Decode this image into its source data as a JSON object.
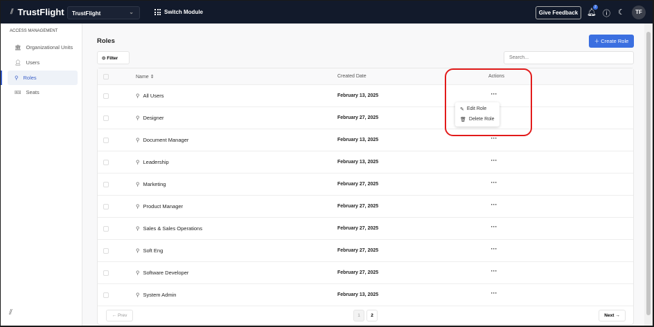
{
  "header": {
    "brand": "TrustFlight",
    "org": "TrustFlight",
    "switch_module": "Switch Module",
    "give_feedback": "Give Feedback",
    "notification_count": "2",
    "avatar": "TF"
  },
  "sidebar": {
    "section": "ACCESS MANAGEMENT",
    "items": [
      {
        "label": "Organizational Units",
        "icon": "bank-icon"
      },
      {
        "label": "Users",
        "icon": "users-icon"
      },
      {
        "label": "Roles",
        "icon": "key-icon",
        "active": true
      },
      {
        "label": "Seats",
        "icon": "ticket-icon"
      }
    ]
  },
  "main": {
    "title": "Roles",
    "create_label": "Create Role",
    "filter_label": "Filter",
    "search_placeholder": "Search...",
    "columns": {
      "name": "Name",
      "created": "Created Date",
      "actions": "Actions"
    },
    "rows": [
      {
        "name": "All Users",
        "date": "February 13, 2025"
      },
      {
        "name": "Designer",
        "date": "February 27, 2025"
      },
      {
        "name": "Document Manager",
        "date": "February 13, 2025"
      },
      {
        "name": "Leadership",
        "date": "February 13, 2025"
      },
      {
        "name": "Marketing",
        "date": "February 27, 2025"
      },
      {
        "name": "Product Manager",
        "date": "February 27, 2025"
      },
      {
        "name": "Sales & Sales Operations",
        "date": "February 27, 2025"
      },
      {
        "name": "Soft Eng",
        "date": "February 27, 2025"
      },
      {
        "name": "Software Developer",
        "date": "February 27, 2025"
      },
      {
        "name": "System Admin",
        "date": "February 13, 2025"
      }
    ],
    "action_menu": {
      "edit": "Edit Role",
      "delete": "Delete Role"
    },
    "pagination": {
      "prev": "Prev",
      "next": "Next",
      "pages": [
        "1",
        "2"
      ]
    }
  },
  "colors": {
    "header_bg": "#121a2b",
    "accent": "#3b6fe0",
    "highlight": "#e21a1a"
  }
}
